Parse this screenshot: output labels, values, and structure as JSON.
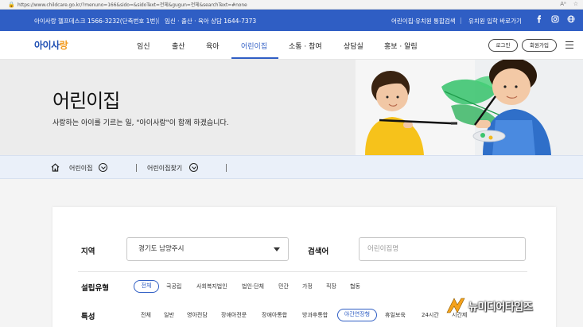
{
  "browser": {
    "url": "https://www.childcare.go.kr/?menuno=166&sido=&sidoText=전체&gugun=전체&searchText=#none"
  },
  "topbar": {
    "helpdesk": "아이사랑 헬프데스크 1566-3232(단축번호 1번)",
    "sep": "|",
    "counsel": "임신 · 출산 · 육아 상담 1644-7373",
    "integrated_search": "어린이집·유치원 통합검색",
    "sep2": "|",
    "kindergarten": "유치원 입학 바로가기",
    "sns": [
      "facebook-icon",
      "instagram-icon",
      "globe-icon"
    ]
  },
  "nav": {
    "logo_main": "아이사",
    "logo_accent": "랑",
    "items": [
      "임신",
      "출산",
      "육아",
      "어린이집",
      "소통 · 참여",
      "상담실",
      "홍보 · 알림"
    ],
    "active": "어린이집",
    "login": "로그인",
    "signup": "회원가입"
  },
  "hero": {
    "title": "어린이집",
    "subtitle": "사랑하는 아이를 기르는 일, \"아이사랑\"이 함께 하겠습니다."
  },
  "breadcrumb": {
    "level1": "어린이집",
    "level2": "어린이집찾기"
  },
  "search": {
    "region_label": "지역",
    "region_value": "경기도 남양주시",
    "keyword_label": "검색어",
    "keyword_placeholder": "어린이집명"
  },
  "filters": {
    "type_label": "설립유형",
    "type_options": [
      "전체",
      "국공립",
      "사회복지법인",
      "법인·단체",
      "민간",
      "가정",
      "직장",
      "협동"
    ],
    "type_selected": "전체",
    "feature_label": "특성",
    "feature_options": [
      "전체",
      "일반",
      "영아전담",
      "장애아전문",
      "장애아통합",
      "방과후통합",
      "야간연장형",
      "휴일보육",
      "24시간",
      "시간제"
    ],
    "feature_selected": "야간연장형"
  },
  "watermark": {
    "text": "뉴미디어타임즈"
  },
  "colors": {
    "brand_blue": "#2f5ec4",
    "logo_orange": "#f29a1d",
    "hero_bg": "#ececec",
    "breadcrumb_bg": "#eaf0f9"
  }
}
